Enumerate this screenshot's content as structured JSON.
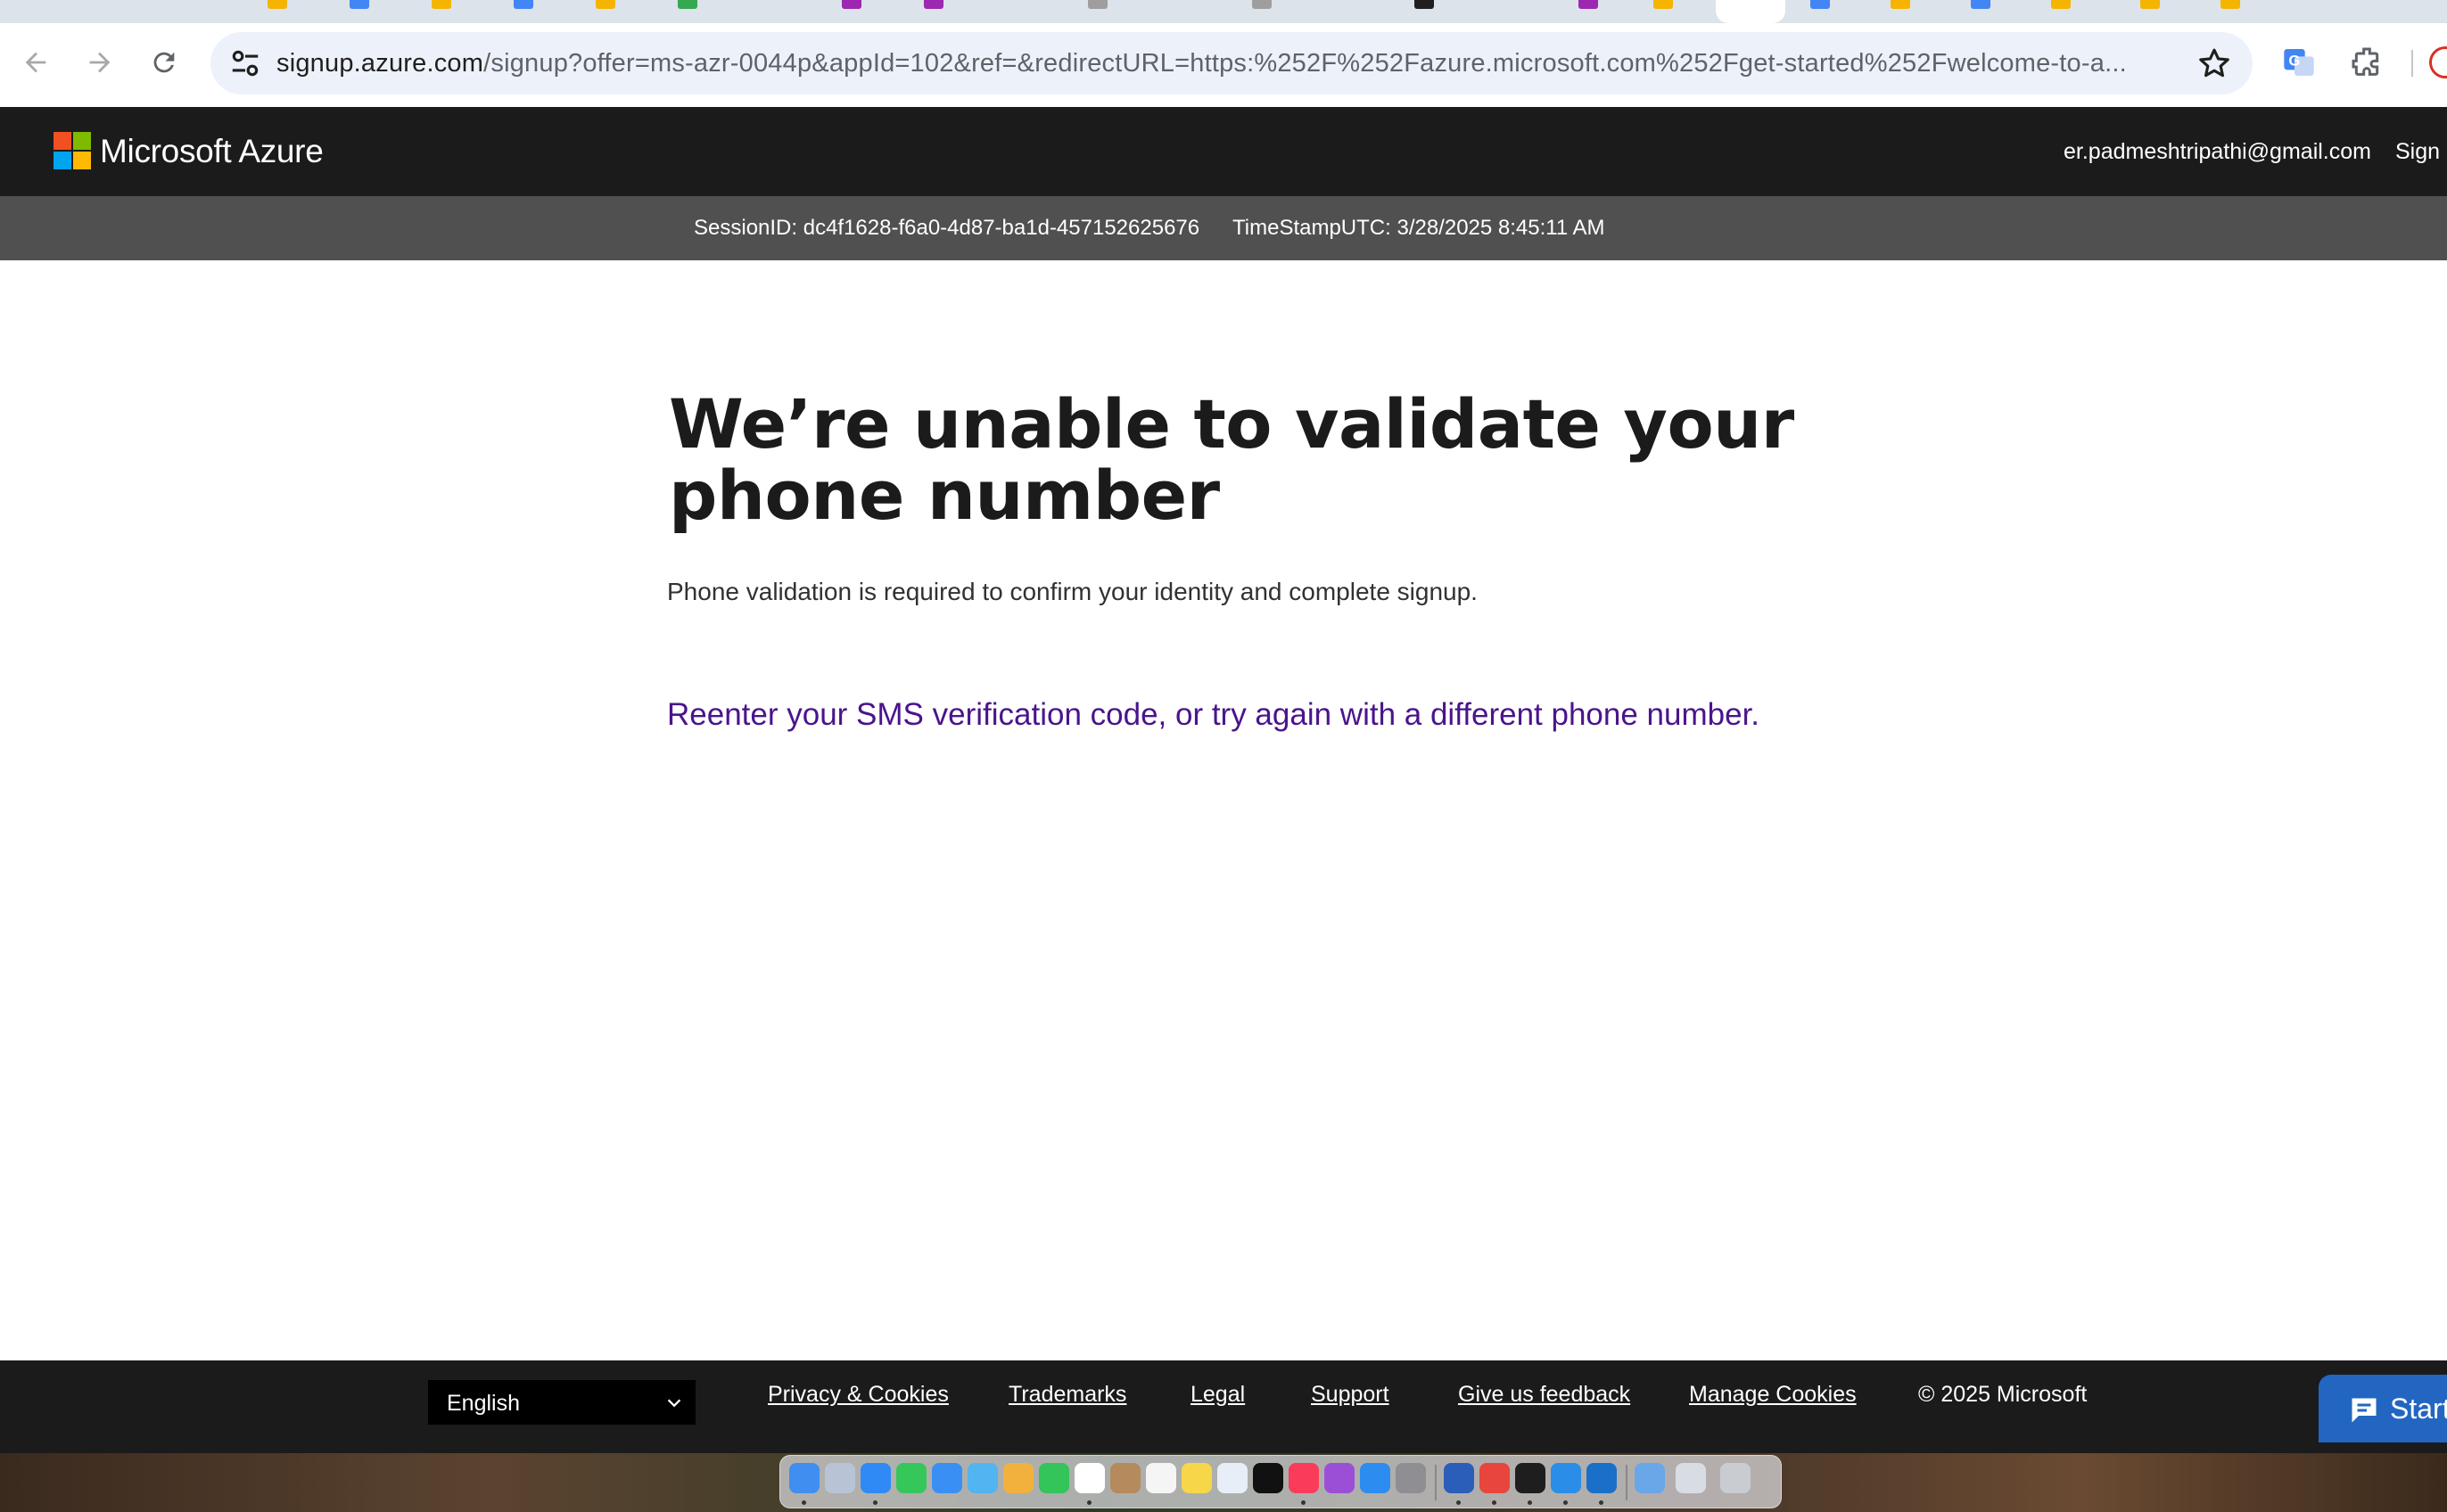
{
  "browser": {
    "url_host": "signup.azure.com",
    "url_rest": "/signup?offer=ms-azr-0044p&appId=102&ref=&redirectURL=https:%252F%252Fazure.microsoft.com%252Fget-started%252Fwelcome-to-a...",
    "icons": [
      "back-icon",
      "forward-icon",
      "reload-icon",
      "site-settings-icon",
      "bookmark-star-icon",
      "translate-icon",
      "extensions-icon"
    ]
  },
  "header": {
    "brand": "Microsoft Azure",
    "user_email": "er.padmeshtripathi@gmail.com",
    "sign_out": "Sign out",
    "logo_colors": [
      "#f25022",
      "#7fba00",
      "#00a4ef",
      "#ffb900"
    ]
  },
  "session": {
    "session_id": "SessionID: dc4f1628-f6a0-4d87-ba1d-457152625676",
    "timestamp": "TimeStampUTC: 3/28/2025 8:45:11 AM"
  },
  "main": {
    "heading": "We’re unable to validate your phone number",
    "subtext": "Phone validation is required to confirm your identity and complete signup.",
    "retry_link": "Reenter your SMS verification code, or try again with a different phone number."
  },
  "footer": {
    "language": "English",
    "links": [
      "Privacy & Cookies",
      "Trademarks",
      "Legal",
      "Support",
      "Give us feedback",
      "Manage Cookies"
    ],
    "copyright": "© 2025 Microsoft",
    "chat_button": "Start"
  },
  "colors": {
    "header_bg": "#1b1b1b",
    "session_bar_bg": "#505050",
    "link_purple": "#4a148c",
    "chat_blue": "#2266c2"
  }
}
